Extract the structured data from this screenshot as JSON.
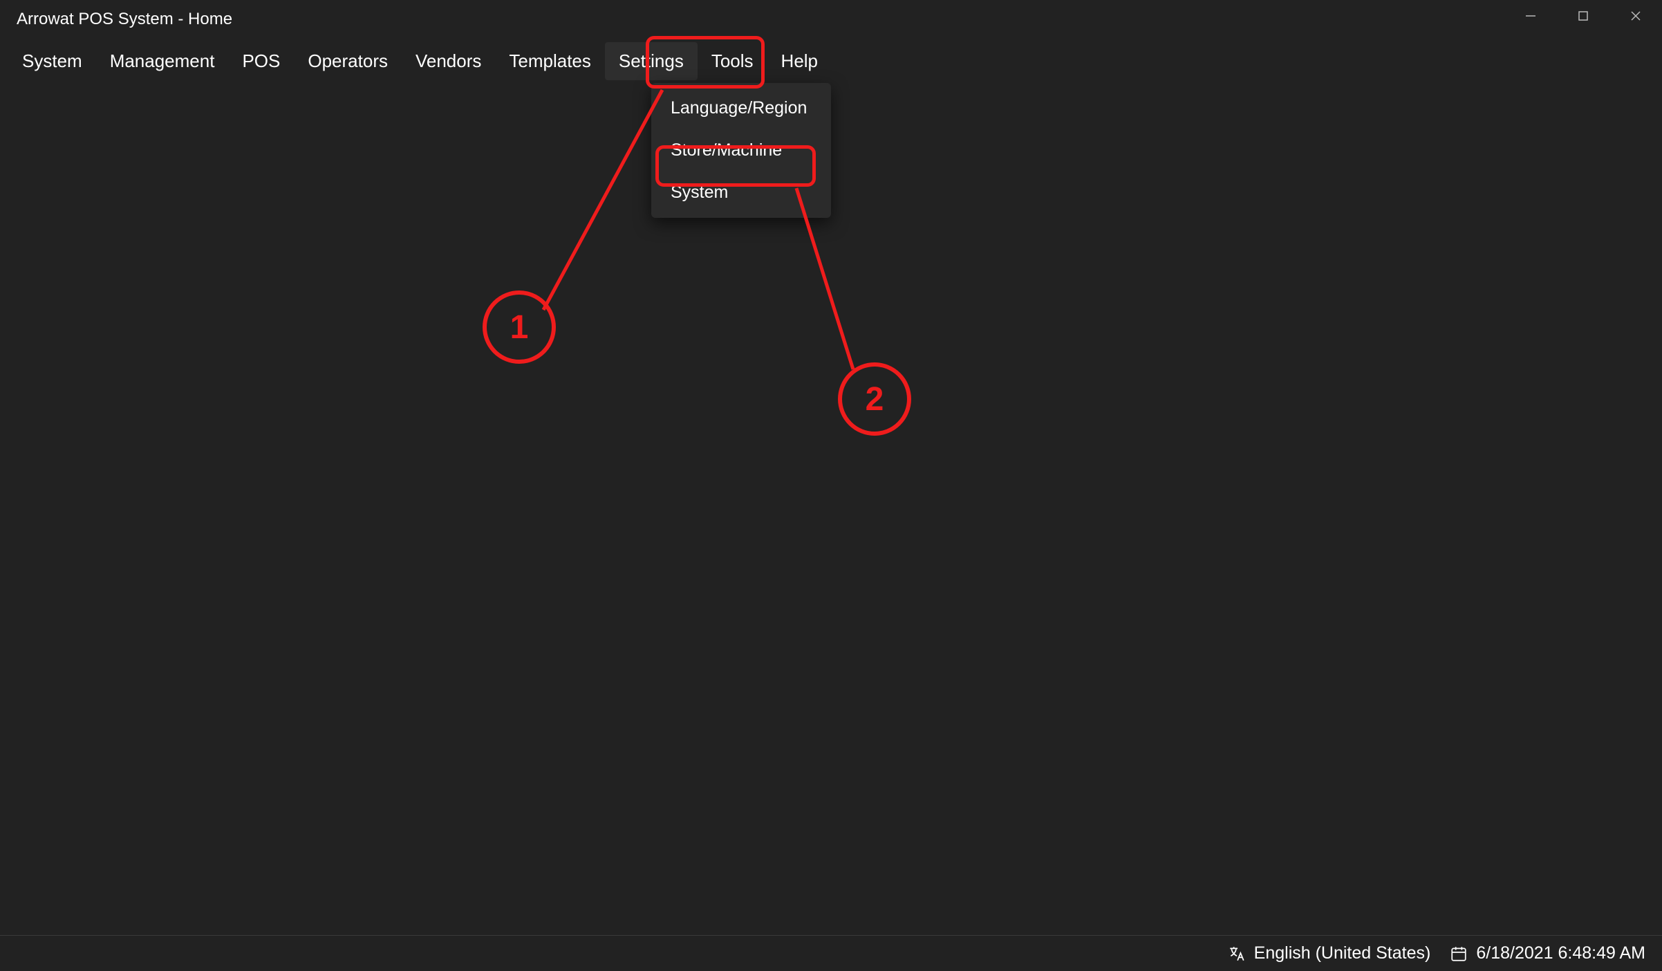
{
  "titlebar": {
    "title": "Arrowat POS System - Home"
  },
  "menubar": {
    "items": [
      {
        "label": "System"
      },
      {
        "label": "Management"
      },
      {
        "label": "POS"
      },
      {
        "label": "Operators"
      },
      {
        "label": "Vendors"
      },
      {
        "label": "Templates"
      },
      {
        "label": "Settings"
      },
      {
        "label": "Tools"
      },
      {
        "label": "Help"
      }
    ]
  },
  "dropdown": {
    "items": [
      {
        "label": "Language/Region"
      },
      {
        "label": "Store/Machine"
      },
      {
        "label": "System"
      }
    ]
  },
  "statusbar": {
    "language": "English (United States)",
    "datetime": "6/18/2021 6:48:49 AM"
  },
  "annotations": {
    "circle1": "1",
    "circle2": "2"
  }
}
